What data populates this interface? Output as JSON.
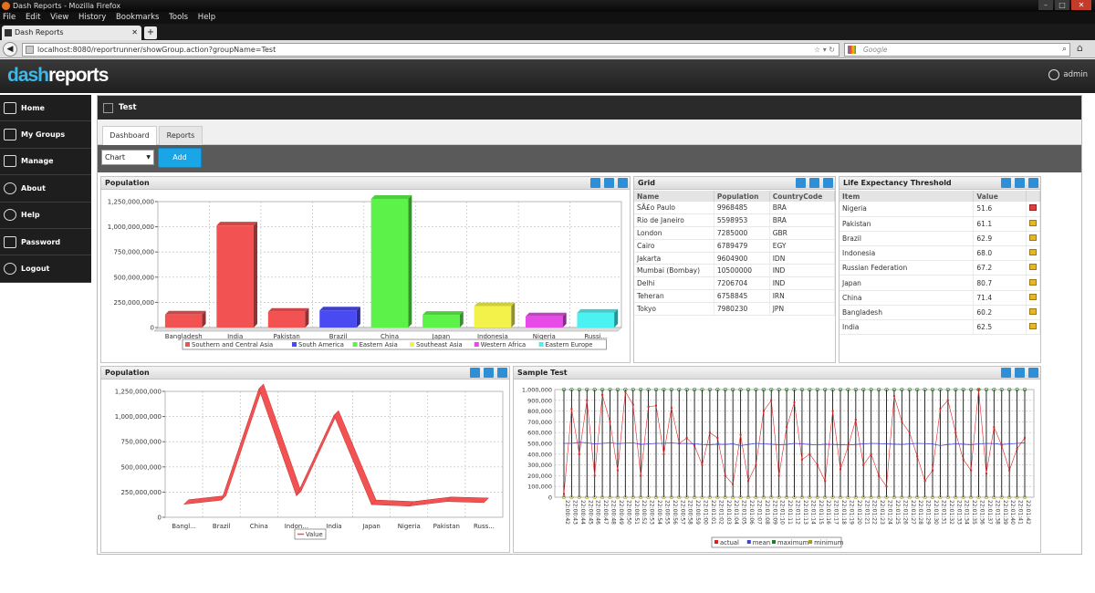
{
  "browser": {
    "window_title": "Dash Reports - Mozilla Firefox",
    "menu": [
      "File",
      "Edit",
      "View",
      "History",
      "Bookmarks",
      "Tools",
      "Help"
    ],
    "tab_title": "Dash Reports",
    "url": "localhost:8080/reportrunner/showGroup.action?groupName=Test",
    "search_placeholder": "Google"
  },
  "app": {
    "logo_part1": "dash",
    "logo_part2": "reports",
    "user": "admin",
    "sidebar": [
      {
        "label": "Home",
        "icon": "home-icon"
      },
      {
        "label": "My Groups",
        "icon": "groups-icon"
      },
      {
        "label": "Manage",
        "icon": "wrench-icon"
      },
      {
        "label": "About",
        "icon": "info-icon"
      },
      {
        "label": "Help",
        "icon": "help-icon"
      },
      {
        "label": "Password",
        "icon": "password-icon"
      },
      {
        "label": "Logout",
        "icon": "logout-icon"
      }
    ],
    "group_title": "Test",
    "tabs": [
      "Dashboard",
      "Reports"
    ],
    "widget_select": "Chart",
    "add_label": "Add",
    "accent_color": "#1aa6e6"
  },
  "panels": {
    "population_bar_title": "Population",
    "grid_title": "Grid",
    "life_title": "Life Expectancy Threshold",
    "population_line_title": "Population",
    "sample_title": "Sample Test"
  },
  "grid": {
    "headers": [
      "Name",
      "Population",
      "CountryCode"
    ],
    "rows": [
      [
        "SÃ£o Paulo",
        "9968485",
        "BRA"
      ],
      [
        "Rio de Janeiro",
        "5598953",
        "BRA"
      ],
      [
        "London",
        "7285000",
        "GBR"
      ],
      [
        "Cairo",
        "6789479",
        "EGY"
      ],
      [
        "Jakarta",
        "9604900",
        "IDN"
      ],
      [
        "Mumbai (Bombay)",
        "10500000",
        "IND"
      ],
      [
        "Delhi",
        "7206704",
        "IND"
      ],
      [
        "Teheran",
        "6758845",
        "IRN"
      ],
      [
        "Tokyo",
        "7980230",
        "JPN"
      ]
    ]
  },
  "life": {
    "headers": [
      "Item",
      "Value"
    ],
    "rows": [
      {
        "item": "Nigeria",
        "value": "51.6",
        "flag": "red"
      },
      {
        "item": "Pakistan",
        "value": "61.1",
        "flag": "yellow"
      },
      {
        "item": "Brazil",
        "value": "62.9",
        "flag": "yellow"
      },
      {
        "item": "Indonesia",
        "value": "68.0",
        "flag": "yellow"
      },
      {
        "item": "Russian Federation",
        "value": "67.2",
        "flag": "yellow"
      },
      {
        "item": "Japan",
        "value": "80.7",
        "flag": "yellow"
      },
      {
        "item": "China",
        "value": "71.4",
        "flag": "yellow"
      },
      {
        "item": "Bangladesh",
        "value": "60.2",
        "flag": "yellow"
      },
      {
        "item": "India",
        "value": "62.5",
        "flag": "yellow"
      }
    ]
  },
  "chart_data": [
    {
      "type": "bar",
      "title": "Population",
      "categories": [
        "Bangladesh",
        "India",
        "Pakistan",
        "Brazil",
        "China",
        "Japan",
        "Indonesia",
        "Nigeria",
        "Russi..."
      ],
      "values": [
        129000000,
        1013000000,
        156000000,
        170000000,
        1277000000,
        126000000,
        212000000,
        111000000,
        146000000
      ],
      "colors": [
        "#f25252",
        "#f25252",
        "#f25252",
        "#4a4af2",
        "#5cf24a",
        "#5cf24a",
        "#f2f24a",
        "#e84ae8",
        "#4af2f2"
      ],
      "ylim": [
        0,
        1250000000
      ],
      "yticks": [
        "0",
        "250,000,000",
        "500,000,000",
        "750,000,000",
        "1,000,000,000",
        "1,250,000,000"
      ],
      "legend": [
        {
          "name": "Southern and Central Asia",
          "color": "#f25252"
        },
        {
          "name": "South America",
          "color": "#4a4af2"
        },
        {
          "name": "Eastern Asia",
          "color": "#5cf24a"
        },
        {
          "name": "Southeast Asia",
          "color": "#f2f24a"
        },
        {
          "name": "Western Africa",
          "color": "#e84ae8"
        },
        {
          "name": "Eastern Europe",
          "color": "#4af2f2"
        }
      ],
      "grid": true
    },
    {
      "type": "line",
      "title": "Population",
      "categories": [
        "Bangl...",
        "Brazil",
        "China",
        "Indon...",
        "India",
        "Japan",
        "Nigeria",
        "Pakistan",
        "Russ..."
      ],
      "values": [
        129000000,
        170000000,
        1277000000,
        212000000,
        1013000000,
        126000000,
        111000000,
        156000000,
        146000000
      ],
      "ylim": [
        0,
        1250000000
      ],
      "yticks": [
        "0",
        "250,000,000",
        "500,000,000",
        "750,000,000",
        "1,000,000,000",
        "1,250,000,000"
      ],
      "legend": [
        {
          "name": "Value",
          "color": "#f25252"
        }
      ],
      "grid": true
    },
    {
      "type": "line",
      "title": "Sample Test",
      "ylim": [
        0,
        1000000
      ],
      "yticks": [
        "0",
        "100,000",
        "200,000",
        "300,000",
        "400,000",
        "500,000",
        "600,000",
        "700,000",
        "800,000",
        "900,000",
        "1,000,000"
      ],
      "x": [
        "22:00:42",
        "22:00:43",
        "22:00:44",
        "22:00:45",
        "22:00:46",
        "22:00:47",
        "22:00:48",
        "22:00:49",
        "22:00:50",
        "22:00:51",
        "22:00:52",
        "22:00:53",
        "22:00:54",
        "22:00:55",
        "22:00:56",
        "22:00:57",
        "22:00:58",
        "22:00:59",
        "22:01:00",
        "22:01:01",
        "22:01:02",
        "22:01:03",
        "22:01:04",
        "22:01:05",
        "22:01:06",
        "22:01:07",
        "22:01:08",
        "22:01:09",
        "22:01:10",
        "22:01:11",
        "22:01:12",
        "22:01:13",
        "22:01:14",
        "22:01:15",
        "22:01:16",
        "22:01:17",
        "22:01:18",
        "22:01:19",
        "22:01:20",
        "22:01:21",
        "22:01:22",
        "22:01:23",
        "22:01:24",
        "22:01:25",
        "22:01:26",
        "22:01:27",
        "22:01:28",
        "22:01:29",
        "22:01:30",
        "22:01:31",
        "22:01:32",
        "22:01:33",
        "22:01:34",
        "22:01:35",
        "22:01:36",
        "22:01:37",
        "22:01:38",
        "22:01:39",
        "22:01:40",
        "22:01:41",
        "22:01:42"
      ],
      "series": [
        {
          "name": "actual",
          "color": "#e02020",
          "values": [
            30000,
            820000,
            400000,
            900000,
            200000,
            950000,
            700000,
            250000,
            980000,
            860000,
            200000,
            840000,
            850000,
            400000,
            830000,
            500000,
            550000,
            480000,
            300000,
            600000,
            550000,
            200000,
            120000,
            580000,
            150000,
            300000,
            800000,
            900000,
            200000,
            650000,
            880000,
            350000,
            400000,
            300000,
            150000,
            800000,
            260000,
            470000,
            720000,
            300000,
            400000,
            200000,
            100000,
            940000,
            700000,
            600000,
            380000,
            150000,
            250000,
            820000,
            900000,
            600000,
            350000,
            250000,
            1000000,
            220000,
            650000,
            480000,
            250000,
            450000,
            550000
          ]
        },
        {
          "name": "mean",
          "color": "#4040e0",
          "values": [
            500000,
            500000,
            510000,
            505000,
            495000,
            500000,
            505000,
            498000,
            502000,
            505000,
            490000,
            495000,
            500000,
            500000,
            505000,
            498000,
            500000,
            495000,
            490000,
            488000,
            492000,
            490000,
            495000,
            480000,
            490000,
            500000,
            495000,
            492000,
            488000,
            490000,
            500000,
            495000,
            490000,
            485000,
            492000,
            490000,
            488000,
            485000,
            490000,
            495000,
            500000,
            498000,
            495000,
            492000,
            490000,
            495000,
            500000,
            498000,
            495000,
            480000,
            490000,
            495000,
            492000,
            488000,
            495000,
            500000,
            498000,
            490000,
            495000,
            500000,
            505000
          ]
        },
        {
          "name": "maximum",
          "color": "#208020",
          "values": [
            1000000,
            1000000,
            1000000,
            1000000,
            1000000,
            1000000,
            1000000,
            1000000,
            1000000,
            1000000,
            1000000,
            1000000,
            1000000,
            1000000,
            1000000,
            1000000,
            1000000,
            1000000,
            1000000,
            1000000,
            1000000,
            1000000,
            1000000,
            1000000,
            1000000,
            1000000,
            1000000,
            1000000,
            1000000,
            1000000,
            1000000,
            1000000,
            1000000,
            1000000,
            1000000,
            1000000,
            1000000,
            1000000,
            1000000,
            1000000,
            1000000,
            1000000,
            1000000,
            1000000,
            1000000,
            1000000,
            1000000,
            1000000,
            1000000,
            1000000,
            1000000,
            1000000,
            1000000,
            1000000,
            1000000,
            1000000,
            1000000,
            1000000,
            1000000,
            1000000,
            1000000
          ]
        },
        {
          "name": "minimum",
          "color": "#a0a020",
          "values": [
            0,
            0,
            0,
            0,
            0,
            0,
            0,
            0,
            0,
            0,
            0,
            0,
            0,
            0,
            0,
            0,
            0,
            0,
            0,
            0,
            0,
            0,
            0,
            0,
            0,
            0,
            0,
            0,
            0,
            0,
            0,
            0,
            0,
            0,
            0,
            0,
            0,
            0,
            0,
            0,
            0,
            0,
            0,
            0,
            0,
            0,
            0,
            0,
            0,
            0,
            0,
            0,
            0,
            0,
            0,
            0,
            0,
            0,
            0,
            0,
            0
          ]
        }
      ],
      "grid": true
    }
  ]
}
